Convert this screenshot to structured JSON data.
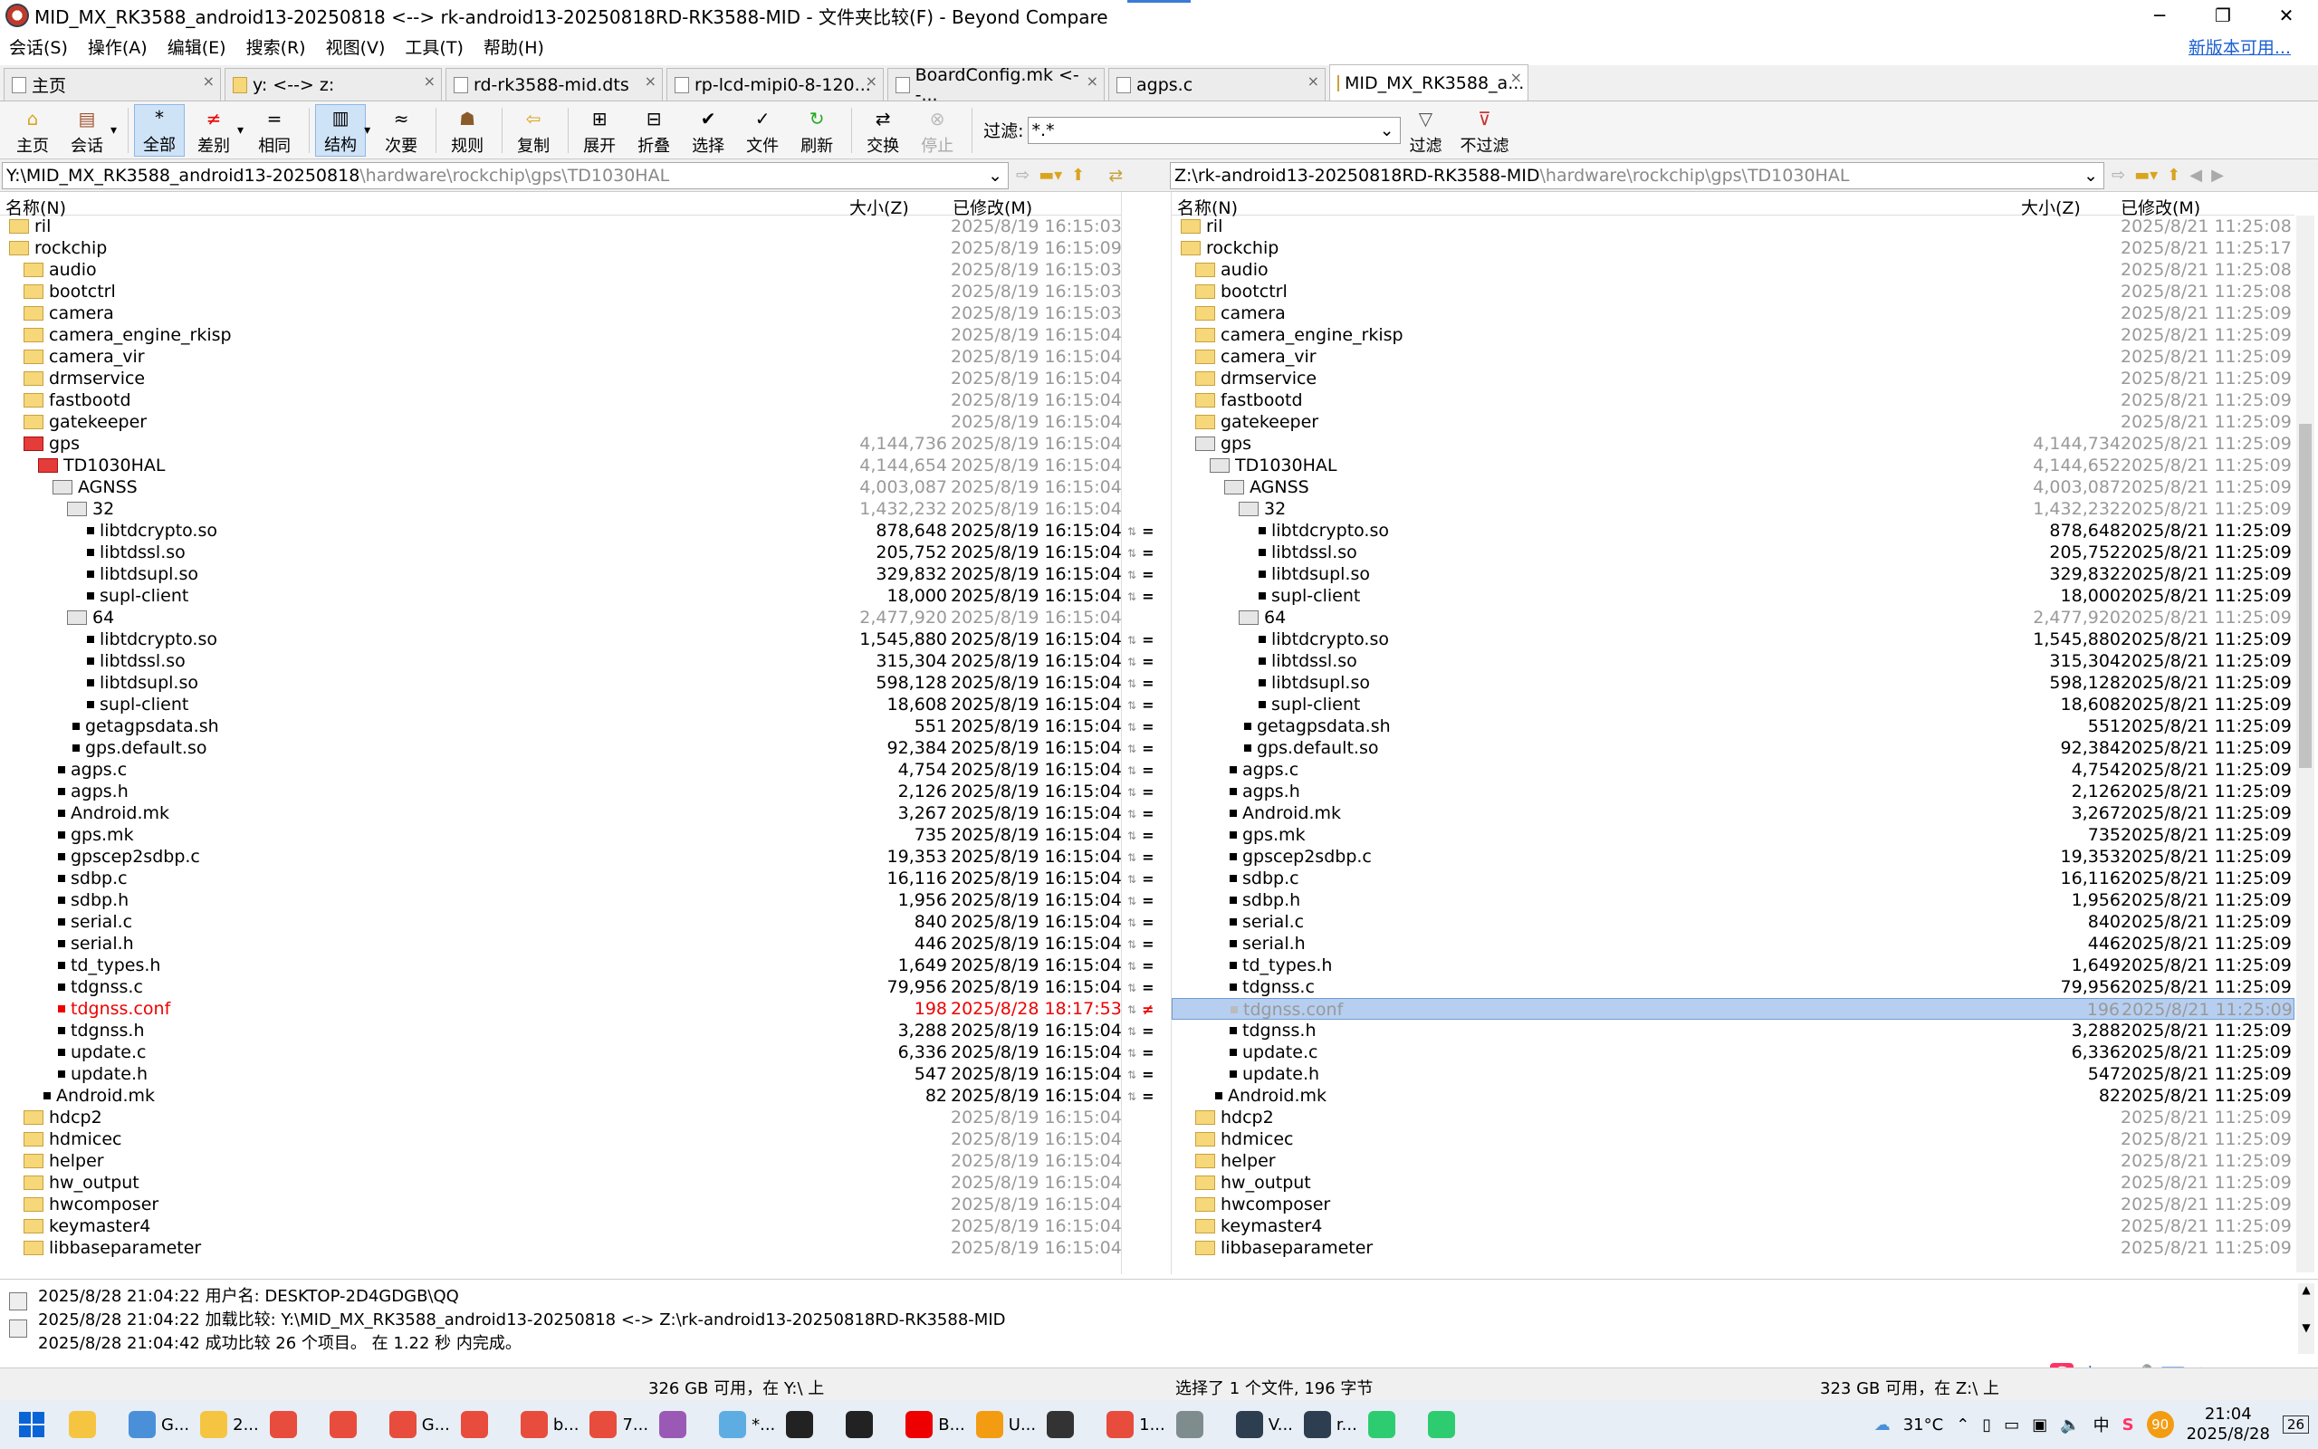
{
  "window": {
    "title": "MID_MX_RK3588_android13-20250818 <--> rk-android13-20250818RD-RK3588-MID - 文件夹比较(F) - Beyond Compare",
    "buttons": [
      "─",
      "❐",
      "✕"
    ]
  },
  "menu": {
    "items": [
      "会话(S)",
      "操作(A)",
      "编辑(E)",
      "搜索(R)",
      "视图(V)",
      "工具(T)",
      "帮助(H)"
    ],
    "newver": "新版本可用..."
  },
  "tabs": [
    {
      "label": "主页",
      "icon": "home-icon"
    },
    {
      "label": "y: <--> z:",
      "icon": "folder-compare-icon"
    },
    {
      "label": "rd-rk3588-mid.dts",
      "icon": "text-compare-icon"
    },
    {
      "label": "rp-lcd-mipi0-8-120...",
      "icon": "text-compare-icon"
    },
    {
      "label": "BoardConfig.mk <--...",
      "icon": "text-compare-icon"
    },
    {
      "label": "agps.c",
      "icon": "text-compare-icon"
    },
    {
      "label": "MID_MX_RK3588_a...",
      "icon": "folder-compare-icon"
    }
  ],
  "toolbar": {
    "items": [
      {
        "label": "主页",
        "icon": "home-icon"
      },
      {
        "label": "会话",
        "icon": "session-icon"
      },
      {
        "label": "全部",
        "icon": "all-icon",
        "sel": true
      },
      {
        "label": "差别",
        "icon": "diff-icon"
      },
      {
        "label": "相同",
        "icon": "same-icon"
      },
      {
        "label": "结构",
        "icon": "structure-icon",
        "sel": true
      },
      {
        "label": "次要",
        "icon": "minor-icon"
      },
      {
        "label": "规则",
        "icon": "rules-icon"
      },
      {
        "label": "复制",
        "icon": "copy-icon"
      },
      {
        "label": "展开",
        "icon": "expand-icon"
      },
      {
        "label": "折叠",
        "icon": "collapse-icon"
      },
      {
        "label": "选择",
        "icon": "select-icon"
      },
      {
        "label": "文件",
        "icon": "files-icon"
      },
      {
        "label": "刷新",
        "icon": "refresh-icon"
      },
      {
        "label": "交换",
        "icon": "swap-icon"
      },
      {
        "label": "停止",
        "icon": "stop-icon",
        "disabled": true
      }
    ],
    "filter_label": "过滤:",
    "filter_value": "*.*",
    "filter_btn": "过滤",
    "nofilter_btn": "不过滤"
  },
  "left_path": {
    "base": "Y:\\MID_MX_RK3588_android13-20250818",
    "rest": "\\hardware\\rockchip\\gps\\TD1030HAL"
  },
  "right_path": {
    "base": "Z:\\rk-android13-20250818RD-RK3588-MID",
    "rest": "\\hardware\\rockchip\\gps\\TD1030HAL"
  },
  "columns": {
    "name": "名称(N)",
    "size": "大小(Z)",
    "modified": "已修改(M)"
  },
  "left_rows": [
    {
      "n": "ril",
      "t": "folder",
      "d": 0,
      "s": "",
      "m": "2025/8/19 16:15:03",
      "c": "g"
    },
    {
      "n": "rockchip",
      "t": "folder-open",
      "d": 0,
      "s": "",
      "m": "2025/8/19 16:15:09",
      "c": "g"
    },
    {
      "n": "audio",
      "t": "folder",
      "d": 1,
      "s": "",
      "m": "2025/8/19 16:15:03",
      "c": "g"
    },
    {
      "n": "bootctrl",
      "t": "folder",
      "d": 1,
      "s": "",
      "m": "2025/8/19 16:15:03",
      "c": "g"
    },
    {
      "n": "camera",
      "t": "folder",
      "d": 1,
      "s": "",
      "m": "2025/8/19 16:15:03",
      "c": "g"
    },
    {
      "n": "camera_engine_rkisp",
      "t": "folder",
      "d": 1,
      "s": "",
      "m": "2025/8/19 16:15:04",
      "c": "g"
    },
    {
      "n": "camera_vir",
      "t": "folder",
      "d": 1,
      "s": "",
      "m": "2025/8/19 16:15:04",
      "c": "g"
    },
    {
      "n": "drmservice",
      "t": "folder",
      "d": 1,
      "s": "",
      "m": "2025/8/19 16:15:04",
      "c": "g"
    },
    {
      "n": "fastbootd",
      "t": "folder",
      "d": 1,
      "s": "",
      "m": "2025/8/19 16:15:04",
      "c": "g"
    },
    {
      "n": "gatekeeper",
      "t": "folder",
      "d": 1,
      "s": "",
      "m": "2025/8/19 16:15:04",
      "c": "g"
    },
    {
      "n": "gps",
      "t": "folder-red",
      "d": 1,
      "s": "4,144,736",
      "m": "2025/8/19 16:15:04",
      "c": "g"
    },
    {
      "n": "TD1030HAL",
      "t": "folder-red",
      "d": 2,
      "s": "4,144,654",
      "m": "2025/8/19 16:15:04",
      "c": "g"
    },
    {
      "n": "AGNSS",
      "t": "folder-gray",
      "d": 3,
      "s": "4,003,087",
      "m": "2025/8/19 16:15:04",
      "c": "g"
    },
    {
      "n": "32",
      "t": "folder-gray",
      "d": 4,
      "s": "1,432,232",
      "m": "2025/8/19 16:15:04",
      "c": "g"
    },
    {
      "n": "libtdcrypto.so",
      "t": "file",
      "d": 5,
      "s": "878,648",
      "m": "2025/8/19 16:15:04",
      "c": "",
      "k": "eq"
    },
    {
      "n": "libtdssl.so",
      "t": "file",
      "d": 5,
      "s": "205,752",
      "m": "2025/8/19 16:15:04",
      "c": "",
      "k": "eq"
    },
    {
      "n": "libtdsupl.so",
      "t": "file",
      "d": 5,
      "s": "329,832",
      "m": "2025/8/19 16:15:04",
      "c": "",
      "k": "eq"
    },
    {
      "n": "supl-client",
      "t": "file",
      "d": 5,
      "s": "18,000",
      "m": "2025/8/19 16:15:04",
      "c": "",
      "k": "eq"
    },
    {
      "n": "64",
      "t": "folder-gray",
      "d": 4,
      "s": "2,477,920",
      "m": "2025/8/19 16:15:04",
      "c": "g"
    },
    {
      "n": "libtdcrypto.so",
      "t": "file",
      "d": 5,
      "s": "1,545,880",
      "m": "2025/8/19 16:15:04",
      "c": "",
      "k": "eq"
    },
    {
      "n": "libtdssl.so",
      "t": "file",
      "d": 5,
      "s": "315,304",
      "m": "2025/8/19 16:15:04",
      "c": "",
      "k": "eq"
    },
    {
      "n": "libtdsupl.so",
      "t": "file",
      "d": 5,
      "s": "598,128",
      "m": "2025/8/19 16:15:04",
      "c": "",
      "k": "eq"
    },
    {
      "n": "supl-client",
      "t": "file",
      "d": 5,
      "s": "18,608",
      "m": "2025/8/19 16:15:04",
      "c": "",
      "k": "eq"
    },
    {
      "n": "getagpsdata.sh",
      "t": "file",
      "d": 4,
      "s": "551",
      "m": "2025/8/19 16:15:04",
      "c": "",
      "k": "eq"
    },
    {
      "n": "gps.default.so",
      "t": "file",
      "d": 4,
      "s": "92,384",
      "m": "2025/8/19 16:15:04",
      "c": "",
      "k": "eq"
    },
    {
      "n": "agps.c",
      "t": "file",
      "d": 3,
      "s": "4,754",
      "m": "2025/8/19 16:15:04",
      "c": "",
      "k": "eq"
    },
    {
      "n": "agps.h",
      "t": "file",
      "d": 3,
      "s": "2,126",
      "m": "2025/8/19 16:15:04",
      "c": "",
      "k": "eq"
    },
    {
      "n": "Android.mk",
      "t": "file",
      "d": 3,
      "s": "3,267",
      "m": "2025/8/19 16:15:04",
      "c": "",
      "k": "eq"
    },
    {
      "n": "gps.mk",
      "t": "file",
      "d": 3,
      "s": "735",
      "m": "2025/8/19 16:15:04",
      "c": "",
      "k": "eq"
    },
    {
      "n": "gpscep2sdbp.c",
      "t": "file",
      "d": 3,
      "s": "19,353",
      "m": "2025/8/19 16:15:04",
      "c": "",
      "k": "eq"
    },
    {
      "n": "sdbp.c",
      "t": "file",
      "d": 3,
      "s": "16,116",
      "m": "2025/8/19 16:15:04",
      "c": "",
      "k": "eq"
    },
    {
      "n": "sdbp.h",
      "t": "file",
      "d": 3,
      "s": "1,956",
      "m": "2025/8/19 16:15:04",
      "c": "",
      "k": "eq"
    },
    {
      "n": "serial.c",
      "t": "file",
      "d": 3,
      "s": "840",
      "m": "2025/8/19 16:15:04",
      "c": "",
      "k": "eq"
    },
    {
      "n": "serial.h",
      "t": "file",
      "d": 3,
      "s": "446",
      "m": "2025/8/19 16:15:04",
      "c": "",
      "k": "eq"
    },
    {
      "n": "td_types.h",
      "t": "file",
      "d": 3,
      "s": "1,649",
      "m": "2025/8/19 16:15:04",
      "c": "",
      "k": "eq"
    },
    {
      "n": "tdgnss.c",
      "t": "file",
      "d": 3,
      "s": "79,956",
      "m": "2025/8/19 16:15:04",
      "c": "",
      "k": "eq"
    },
    {
      "n": "tdgnss.conf",
      "t": "file-red",
      "d": 3,
      "s": "198",
      "m": "2025/8/28 18:17:53",
      "c": "r",
      "k": "neq"
    },
    {
      "n": "tdgnss.h",
      "t": "file",
      "d": 3,
      "s": "3,288",
      "m": "2025/8/19 16:15:04",
      "c": "",
      "k": "eq"
    },
    {
      "n": "update.c",
      "t": "file",
      "d": 3,
      "s": "6,336",
      "m": "2025/8/19 16:15:04",
      "c": "",
      "k": "eq"
    },
    {
      "n": "update.h",
      "t": "file",
      "d": 3,
      "s": "547",
      "m": "2025/8/19 16:15:04",
      "c": "",
      "k": "eq"
    },
    {
      "n": "Android.mk",
      "t": "file",
      "d": 2,
      "s": "82",
      "m": "2025/8/19 16:15:04",
      "c": "",
      "k": "eq"
    },
    {
      "n": "hdcp2",
      "t": "folder",
      "d": 1,
      "s": "",
      "m": "2025/8/19 16:15:04",
      "c": "g"
    },
    {
      "n": "hdmicec",
      "t": "folder",
      "d": 1,
      "s": "",
      "m": "2025/8/19 16:15:04",
      "c": "g"
    },
    {
      "n": "helper",
      "t": "folder",
      "d": 1,
      "s": "",
      "m": "2025/8/19 16:15:04",
      "c": "g"
    },
    {
      "n": "hw_output",
      "t": "folder",
      "d": 1,
      "s": "",
      "m": "2025/8/19 16:15:04",
      "c": "g"
    },
    {
      "n": "hwcomposer",
      "t": "folder",
      "d": 1,
      "s": "",
      "m": "2025/8/19 16:15:04",
      "c": "g"
    },
    {
      "n": "keymaster4",
      "t": "folder",
      "d": 1,
      "s": "",
      "m": "2025/8/19 16:15:04",
      "c": "g"
    },
    {
      "n": "libbaseparameter",
      "t": "folder",
      "d": 1,
      "s": "",
      "m": "2025/8/19 16:15:04",
      "c": "g"
    }
  ],
  "right_rows": [
    {
      "n": "ril",
      "t": "folder",
      "d": 0,
      "s": "",
      "m": "2025/8/21 11:25:08",
      "c": "g"
    },
    {
      "n": "rockchip",
      "t": "folder-open",
      "d": 0,
      "s": "",
      "m": "2025/8/21 11:25:17",
      "c": "g"
    },
    {
      "n": "audio",
      "t": "folder",
      "d": 1,
      "s": "",
      "m": "2025/8/21 11:25:08",
      "c": "g"
    },
    {
      "n": "bootctrl",
      "t": "folder",
      "d": 1,
      "s": "",
      "m": "2025/8/21 11:25:08",
      "c": "g"
    },
    {
      "n": "camera",
      "t": "folder",
      "d": 1,
      "s": "",
      "m": "2025/8/21 11:25:09",
      "c": "g"
    },
    {
      "n": "camera_engine_rkisp",
      "t": "folder",
      "d": 1,
      "s": "",
      "m": "2025/8/21 11:25:09",
      "c": "g"
    },
    {
      "n": "camera_vir",
      "t": "folder",
      "d": 1,
      "s": "",
      "m": "2025/8/21 11:25:09",
      "c": "g"
    },
    {
      "n": "drmservice",
      "t": "folder",
      "d": 1,
      "s": "",
      "m": "2025/8/21 11:25:09",
      "c": "g"
    },
    {
      "n": "fastbootd",
      "t": "folder",
      "d": 1,
      "s": "",
      "m": "2025/8/21 11:25:09",
      "c": "g"
    },
    {
      "n": "gatekeeper",
      "t": "folder",
      "d": 1,
      "s": "",
      "m": "2025/8/21 11:25:09",
      "c": "g"
    },
    {
      "n": "gps",
      "t": "folder-gray",
      "d": 1,
      "s": "4,144,734",
      "m": "2025/8/21 11:25:09",
      "c": "g"
    },
    {
      "n": "TD1030HAL",
      "t": "folder-gray",
      "d": 2,
      "s": "4,144,652",
      "m": "2025/8/21 11:25:09",
      "c": "g"
    },
    {
      "n": "AGNSS",
      "t": "folder-gray",
      "d": 3,
      "s": "4,003,087",
      "m": "2025/8/21 11:25:09",
      "c": "g"
    },
    {
      "n": "32",
      "t": "folder-gray",
      "d": 4,
      "s": "1,432,232",
      "m": "2025/8/21 11:25:09",
      "c": "g"
    },
    {
      "n": "libtdcrypto.so",
      "t": "file",
      "d": 5,
      "s": "878,648",
      "m": "2025/8/21 11:25:09",
      "c": ""
    },
    {
      "n": "libtdssl.so",
      "t": "file",
      "d": 5,
      "s": "205,752",
      "m": "2025/8/21 11:25:09",
      "c": ""
    },
    {
      "n": "libtdsupl.so",
      "t": "file",
      "d": 5,
      "s": "329,832",
      "m": "2025/8/21 11:25:09",
      "c": ""
    },
    {
      "n": "supl-client",
      "t": "file",
      "d": 5,
      "s": "18,000",
      "m": "2025/8/21 11:25:09",
      "c": ""
    },
    {
      "n": "64",
      "t": "folder-gray",
      "d": 4,
      "s": "2,477,920",
      "m": "2025/8/21 11:25:09",
      "c": "g"
    },
    {
      "n": "libtdcrypto.so",
      "t": "file",
      "d": 5,
      "s": "1,545,880",
      "m": "2025/8/21 11:25:09",
      "c": ""
    },
    {
      "n": "libtdssl.so",
      "t": "file",
      "d": 5,
      "s": "315,304",
      "m": "2025/8/21 11:25:09",
      "c": ""
    },
    {
      "n": "libtdsupl.so",
      "t": "file",
      "d": 5,
      "s": "598,128",
      "m": "2025/8/21 11:25:09",
      "c": ""
    },
    {
      "n": "supl-client",
      "t": "file",
      "d": 5,
      "s": "18,608",
      "m": "2025/8/21 11:25:09",
      "c": ""
    },
    {
      "n": "getagpsdata.sh",
      "t": "file",
      "d": 4,
      "s": "551",
      "m": "2025/8/21 11:25:09",
      "c": ""
    },
    {
      "n": "gps.default.so",
      "t": "file",
      "d": 4,
      "s": "92,384",
      "m": "2025/8/21 11:25:09",
      "c": ""
    },
    {
      "n": "agps.c",
      "t": "file",
      "d": 3,
      "s": "4,754",
      "m": "2025/8/21 11:25:09",
      "c": ""
    },
    {
      "n": "agps.h",
      "t": "file",
      "d": 3,
      "s": "2,126",
      "m": "2025/8/21 11:25:09",
      "c": ""
    },
    {
      "n": "Android.mk",
      "t": "file",
      "d": 3,
      "s": "3,267",
      "m": "2025/8/21 11:25:09",
      "c": ""
    },
    {
      "n": "gps.mk",
      "t": "file",
      "d": 3,
      "s": "735",
      "m": "2025/8/21 11:25:09",
      "c": ""
    },
    {
      "n": "gpscep2sdbp.c",
      "t": "file",
      "d": 3,
      "s": "19,353",
      "m": "2025/8/21 11:25:09",
      "c": ""
    },
    {
      "n": "sdbp.c",
      "t": "file",
      "d": 3,
      "s": "16,116",
      "m": "2025/8/21 11:25:09",
      "c": ""
    },
    {
      "n": "sdbp.h",
      "t": "file",
      "d": 3,
      "s": "1,956",
      "m": "2025/8/21 11:25:09",
      "c": ""
    },
    {
      "n": "serial.c",
      "t": "file",
      "d": 3,
      "s": "840",
      "m": "2025/8/21 11:25:09",
      "c": ""
    },
    {
      "n": "serial.h",
      "t": "file",
      "d": 3,
      "s": "446",
      "m": "2025/8/21 11:25:09",
      "c": ""
    },
    {
      "n": "td_types.h",
      "t": "file",
      "d": 3,
      "s": "1,649",
      "m": "2025/8/21 11:25:09",
      "c": ""
    },
    {
      "n": "tdgnss.c",
      "t": "file",
      "d": 3,
      "s": "79,956",
      "m": "2025/8/21 11:25:09",
      "c": ""
    },
    {
      "n": "tdgnss.conf",
      "t": "file-gray",
      "d": 3,
      "s": "196",
      "m": "2025/8/21 11:25:09",
      "c": "g",
      "sel": true
    },
    {
      "n": "tdgnss.h",
      "t": "file",
      "d": 3,
      "s": "3,288",
      "m": "2025/8/21 11:25:09",
      "c": ""
    },
    {
      "n": "update.c",
      "t": "file",
      "d": 3,
      "s": "6,336",
      "m": "2025/8/21 11:25:09",
      "c": ""
    },
    {
      "n": "update.h",
      "t": "file",
      "d": 3,
      "s": "547",
      "m": "2025/8/21 11:25:09",
      "c": ""
    },
    {
      "n": "Android.mk",
      "t": "file",
      "d": 2,
      "s": "82",
      "m": "2025/8/21 11:25:09",
      "c": ""
    },
    {
      "n": "hdcp2",
      "t": "folder",
      "d": 1,
      "s": "",
      "m": "2025/8/21 11:25:09",
      "c": "g"
    },
    {
      "n": "hdmicec",
      "t": "folder",
      "d": 1,
      "s": "",
      "m": "2025/8/21 11:25:09",
      "c": "g"
    },
    {
      "n": "helper",
      "t": "folder",
      "d": 1,
      "s": "",
      "m": "2025/8/21 11:25:09",
      "c": "g"
    },
    {
      "n": "hw_output",
      "t": "folder",
      "d": 1,
      "s": "",
      "m": "2025/8/21 11:25:09",
      "c": "g"
    },
    {
      "n": "hwcomposer",
      "t": "folder",
      "d": 1,
      "s": "",
      "m": "2025/8/21 11:25:09",
      "c": "g"
    },
    {
      "n": "keymaster4",
      "t": "folder",
      "d": 1,
      "s": "",
      "m": "2025/8/21 11:25:09",
      "c": "g"
    },
    {
      "n": "libbaseparameter",
      "t": "folder",
      "d": 1,
      "s": "",
      "m": "2025/8/21 11:25:09",
      "c": "g"
    }
  ],
  "log": [
    "2025/8/28 21:04:22  用户名: DESKTOP-2D4GDGB\\QQ",
    "2025/8/28 21:04:22  加载比较: Y:\\MID_MX_RK3588_android13-20250818 <-> Z:\\rk-android13-20250818RD-RK3588-MID",
    "2025/8/28 21:04:42  成功比较 26 个项目。 在 1.22 秒 内完成。"
  ],
  "status": {
    "left": "326 GB 可用，在 Y:\\ 上",
    "mid": "选择了 1 个文件, 196 字节",
    "right": "323 GB 可用，在 Z:\\ 上"
  },
  "taskbar": {
    "apps": [
      {
        "label": "",
        "color": "#f5c542"
      },
      {
        "label": "G...",
        "color": "#4a90d9"
      },
      {
        "label": "2...",
        "color": "#f5c542"
      },
      {
        "label": "",
        "color": "#e74c3c"
      },
      {
        "label": "",
        "color": "#e74c3c"
      },
      {
        "label": "G...",
        "color": "#e74c3c"
      },
      {
        "label": "",
        "color": "#e74c3c"
      },
      {
        "label": "b...",
        "color": "#e74c3c"
      },
      {
        "label": "7...",
        "color": "#e74c3c"
      },
      {
        "label": "",
        "color": "#9b59b6"
      },
      {
        "label": "*...",
        "color": "#5dade2"
      },
      {
        "label": "",
        "color": "#222"
      },
      {
        "label": "",
        "color": "#222"
      },
      {
        "label": "B...",
        "color": "#e00"
      },
      {
        "label": "U...",
        "color": "#f39c12"
      },
      {
        "label": "",
        "color": "#333"
      },
      {
        "label": "1...",
        "color": "#e74c3c"
      },
      {
        "label": "",
        "color": "#7f8c8d"
      },
      {
        "label": "V...",
        "color": "#2c3e50"
      },
      {
        "label": "r...",
        "color": "#2c3e50"
      },
      {
        "label": "",
        "color": "#2ecc71"
      },
      {
        "label": "",
        "color": "#2ecc71"
      }
    ],
    "weather": "31°C",
    "ime": "中",
    "badge": "90",
    "time": "21:04",
    "date": "2025/8/28",
    "notif": "26"
  }
}
